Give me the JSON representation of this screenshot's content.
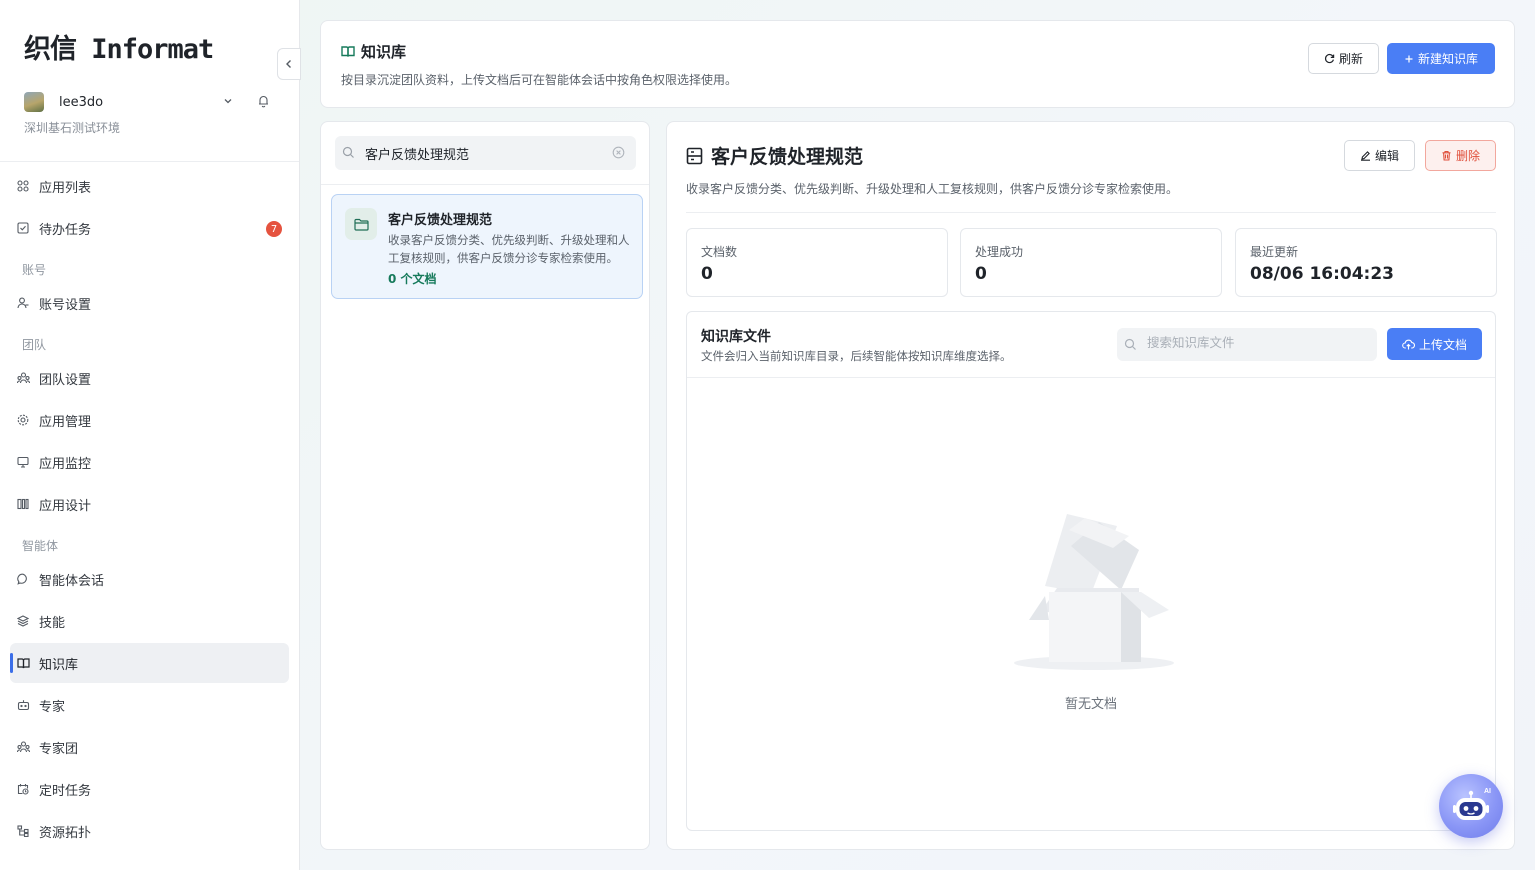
{
  "brand": {
    "logo_text": "织信 Informat"
  },
  "user": {
    "name": "lee3do",
    "environment": "深圳基石测试环境"
  },
  "nav": {
    "items": [
      {
        "label": "应用列表"
      },
      {
        "label": "待办任务",
        "badge": "7"
      },
      {
        "label": "账号设置"
      },
      {
        "label": "团队设置"
      },
      {
        "label": "应用管理"
      },
      {
        "label": "应用监控"
      },
      {
        "label": "应用设计"
      },
      {
        "label": "智能体会话"
      },
      {
        "label": "技能"
      },
      {
        "label": "知识库"
      },
      {
        "label": "专家"
      },
      {
        "label": "专家团"
      },
      {
        "label": "定时任务"
      },
      {
        "label": "资源拓扑"
      }
    ],
    "sections": {
      "account": "账号",
      "team": "团队",
      "agent": "智能体"
    }
  },
  "header": {
    "title": "知识库",
    "description": "按目录沉淀团队资料，上传文档后可在智能体会话中按角色权限选择使用。",
    "refresh_label": "刷新",
    "new_label": "新建知识库"
  },
  "list": {
    "search_value": "客户反馈处理规范",
    "items": [
      {
        "name": "客户反馈处理规范",
        "description": "收录客户反馈分类、优先级判断、升级处理和人工复核规则，供客户反馈分诊专家检索使用。",
        "count": "0 个文档"
      }
    ]
  },
  "detail": {
    "title": "客户反馈处理规范",
    "description": "收录客户反馈分类、优先级判断、升级处理和人工复核规则，供客户反馈分诊专家检索使用。",
    "edit_label": "编辑",
    "delete_label": "删除",
    "stats": [
      {
        "label": "文档数",
        "value": "0"
      },
      {
        "label": "处理成功",
        "value": "0"
      },
      {
        "label": "最近更新",
        "value": "08/06 16:04:23"
      }
    ],
    "files": {
      "title": "知识库文件",
      "description": "文件会归入当前知识库目录，后续智能体按知识库维度选择。",
      "search_placeholder": "搜索知识库文件",
      "upload_label": "上传文档",
      "empty_text": "暂无文档"
    }
  },
  "colors": {
    "primary": "#4a7ef5",
    "danger": "#e0503c",
    "success": "#167a5b",
    "badge": "#e5533f"
  }
}
